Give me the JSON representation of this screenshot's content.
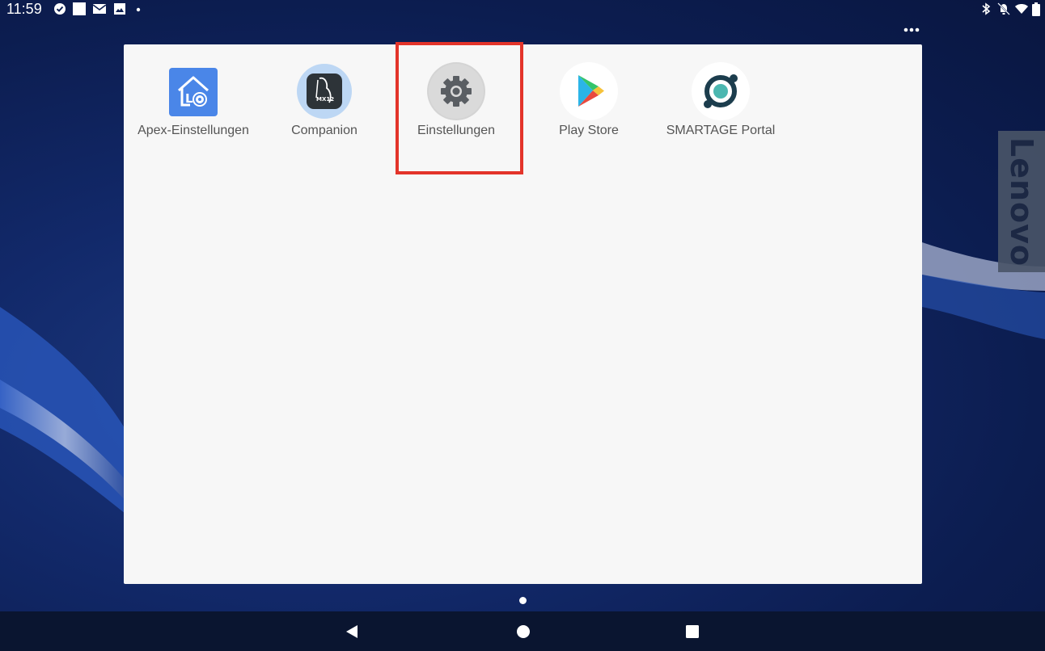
{
  "status_bar": {
    "time": "11:59",
    "left_icons": [
      "check-circle-icon",
      "square-icon",
      "mail-icon",
      "image-icon",
      "dot-icon"
    ],
    "right_icons": [
      "bluetooth-icon",
      "notifications-off-icon",
      "wifi-icon",
      "battery-icon"
    ]
  },
  "wallpaper": {
    "brand": "Lenovo",
    "brand_text": "Lenovo"
  },
  "drawer": {
    "apps": [
      {
        "label": "Apex-Einstellungen",
        "icon": "apex-settings-icon"
      },
      {
        "label": "Companion",
        "icon": "companion-icon"
      },
      {
        "label": "Einstellungen",
        "icon": "settings-gear-icon",
        "highlighted": true
      },
      {
        "label": "Play Store",
        "icon": "play-store-icon"
      },
      {
        "label": "SMARTAGE Portal",
        "icon": "smartage-portal-icon"
      }
    ],
    "companion_badge": "MX12"
  },
  "highlight_color": "#e3342a",
  "navigation": {
    "back": "back-icon",
    "home": "home-icon",
    "recents": "recents-icon"
  }
}
